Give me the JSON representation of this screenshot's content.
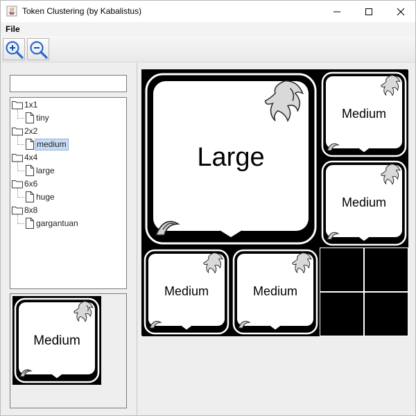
{
  "window": {
    "title": "Token Clustering (by Kabalistus)"
  },
  "menu": {
    "file": "File"
  },
  "toolbar": {
    "zoom_in": "zoom-in-icon",
    "zoom_out": "zoom-out-icon"
  },
  "search": {
    "value": ""
  },
  "tree": {
    "folders": [
      {
        "label": "1x1",
        "items": [
          "tiny"
        ]
      },
      {
        "label": "2x2",
        "items": [
          "medium"
        ]
      },
      {
        "label": "4x4",
        "items": [
          "large"
        ]
      },
      {
        "label": "6x6",
        "items": [
          "huge"
        ]
      },
      {
        "label": "8x8",
        "items": [
          "gargantuan"
        ]
      }
    ],
    "selected": "medium"
  },
  "preview": {
    "label": "Medium"
  },
  "grid": {
    "large": "Large",
    "medium_1": "Medium",
    "medium_2": "Medium",
    "medium_3": "Medium",
    "medium_4": "Medium"
  },
  "colors": {
    "selection": "#c8dcf5",
    "token_frame": "#000000",
    "token_face": "#ffffff"
  }
}
